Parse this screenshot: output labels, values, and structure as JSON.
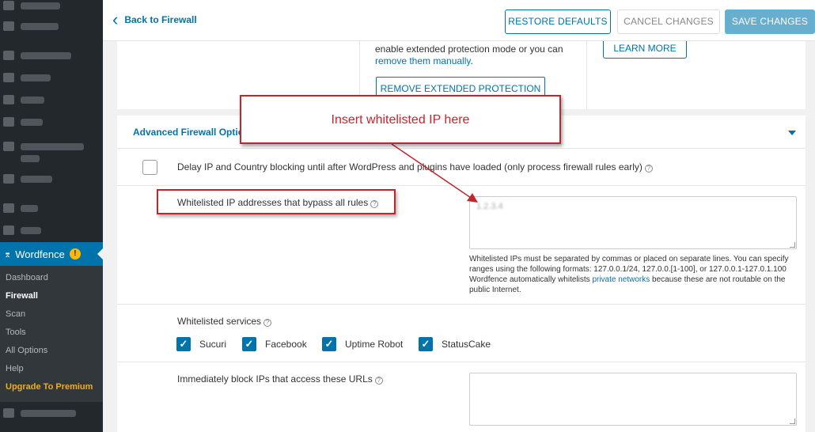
{
  "sidebar": {
    "active_item": {
      "label": "Wordfence",
      "badge": "!"
    },
    "submenu": [
      {
        "label": "Dashboard"
      },
      {
        "label": "Firewall"
      },
      {
        "label": "Scan"
      },
      {
        "label": "Tools"
      },
      {
        "label": "All Options"
      },
      {
        "label": "Help"
      },
      {
        "label": "Upgrade To Premium"
      }
    ]
  },
  "header": {
    "back_label": "Back to Firewall",
    "restore_label": "RESTORE DEFAULTS",
    "cancel_label": "CANCEL CHANGES",
    "save_label": "SAVE CHANGES"
  },
  "extended_protection": {
    "text_line1": "enable extended protection mode or you can",
    "text_link": "remove them manually",
    "text_end": ".",
    "remove_button": "REMOVE EXTENDED PROTECTION",
    "learn_more_button": "LEARN MORE"
  },
  "advanced": {
    "title": "Advanced Firewall Option",
    "delay_label": "Delay IP and Country blocking until after WordPress and plugins have loaded (only process firewall rules early)",
    "whitelist_label": "Whitelisted IP addresses that bypass all rules",
    "whitelist_value": "1.2.3.4",
    "whitelist_help_1": "Whitelisted IPs must be separated by commas or placed on separate lines. You can specify ranges using the following formats: 127.0.0.1/24, 127.0.0.[1-100], or 127.0.0.1-127.0.1.100",
    "whitelist_help_2": "Wordfence automatically whitelists",
    "whitelist_help_link": "private networks",
    "whitelist_help_3": "because these are not routable on the public Internet.",
    "services_label": "Whitelisted services",
    "services": [
      {
        "name": "Sucuri",
        "checked": true
      },
      {
        "name": "Facebook",
        "checked": true
      },
      {
        "name": "Uptime Robot",
        "checked": true
      },
      {
        "name": "StatusCake",
        "checked": true
      }
    ],
    "block_urls_label": "Immediately block IPs that access these URLs"
  },
  "annotation": {
    "callout_text": "Insert whitelisted IP here",
    "color": "#c0272d"
  },
  "colors": {
    "accent": "#0073aa",
    "sidebar_bg": "#23282d",
    "premium": "#f0ad1c"
  }
}
